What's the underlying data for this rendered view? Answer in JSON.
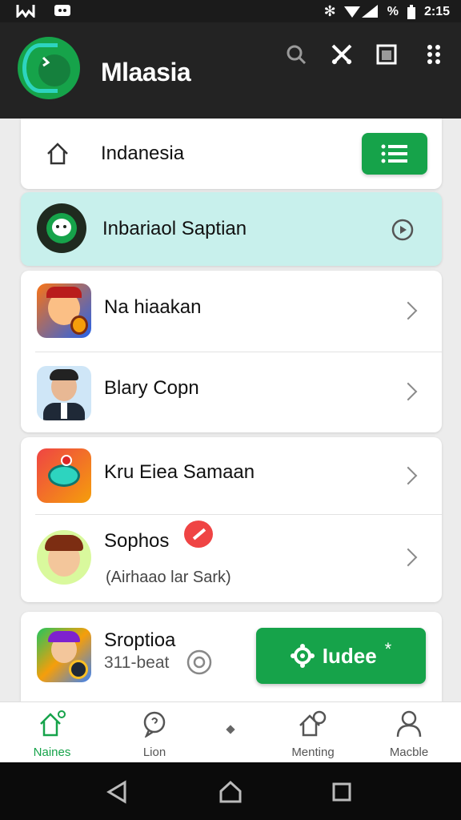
{
  "status_bar": {
    "time": "2:15",
    "battery_percent_symbol": "%"
  },
  "app_bar": {
    "title": "Mlaasia",
    "actions": [
      "search-icon",
      "tools-icon",
      "window-icon",
      "more-vert-icon"
    ]
  },
  "home_row": {
    "label": "Indanesia"
  },
  "featured_row": {
    "label": "Inbariaol Saptian"
  },
  "list": {
    "items": [
      {
        "title": "Na hiaakan"
      },
      {
        "title": "Blary Copn"
      },
      {
        "title": "Kru Eiea Samaan"
      },
      {
        "title": "Sophos",
        "subtitle": "(Airhaao lar Sark)"
      }
    ]
  },
  "bottom_card": {
    "title": "Sroptioa",
    "subtitle": "311-beat",
    "button_label": "Iudee"
  },
  "bottom_nav": {
    "items": [
      {
        "label": "Naines",
        "active": true
      },
      {
        "label": "Lion",
        "active": false
      },
      {
        "label": "Menting",
        "active": false
      },
      {
        "label": "Macble",
        "active": false
      }
    ]
  },
  "colors": {
    "accent": "#16a34a",
    "highlight_bg": "#c8f0ec",
    "appbar_bg": "#232323"
  }
}
